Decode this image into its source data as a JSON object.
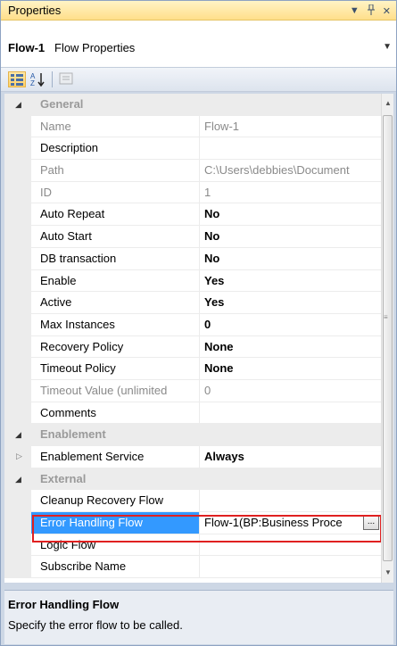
{
  "window": {
    "title": "Properties",
    "menu_icon": "▼",
    "pin_icon": "ꟸ",
    "close_icon": "✕"
  },
  "selector": {
    "name": "Flow-1",
    "type": "Flow Properties"
  },
  "toolbar": {
    "categorized_icon": "categorized-icon",
    "alphabetical_icon": "alphabetical-icon",
    "property_pages_icon": "property-pages-icon"
  },
  "grid": {
    "rows": [
      {
        "kind": "category",
        "label": "General",
        "expanded": true
      },
      {
        "kind": "prop",
        "name": "Name",
        "value": "Flow-1",
        "readonly": true
      },
      {
        "kind": "prop",
        "name": "Description",
        "value": ""
      },
      {
        "kind": "prop",
        "name": "Path",
        "value": "C:\\Users\\debbies\\Document",
        "readonly": true
      },
      {
        "kind": "prop",
        "name": "ID",
        "value": "1",
        "readonly": true
      },
      {
        "kind": "prop",
        "name": "Auto Repeat",
        "value": "No",
        "bold": true
      },
      {
        "kind": "prop",
        "name": "Auto Start",
        "value": "No",
        "bold": true
      },
      {
        "kind": "prop",
        "name": "DB transaction",
        "value": "No",
        "bold": true
      },
      {
        "kind": "prop",
        "name": "Enable",
        "value": "Yes",
        "bold": true
      },
      {
        "kind": "prop",
        "name": "Active",
        "value": "Yes",
        "bold": true
      },
      {
        "kind": "prop",
        "name": "Max Instances",
        "value": "0",
        "bold": true
      },
      {
        "kind": "prop",
        "name": "Recovery Policy",
        "value": "None",
        "bold": true
      },
      {
        "kind": "prop",
        "name": "Timeout Policy",
        "value": "None",
        "bold": true
      },
      {
        "kind": "prop",
        "name": "Timeout Value (unlimited",
        "value": "0",
        "readonly": true
      },
      {
        "kind": "prop",
        "name": "Comments",
        "value": ""
      },
      {
        "kind": "category",
        "label": "Enablement",
        "expanded": true
      },
      {
        "kind": "prop",
        "name": "Enablement Service",
        "value": "Always",
        "bold": true,
        "expander": true
      },
      {
        "kind": "category",
        "label": "External",
        "expanded": true
      },
      {
        "kind": "prop",
        "name": "Cleanup Recovery Flow",
        "value": ""
      },
      {
        "kind": "prop",
        "name": "Error Handling Flow",
        "value": "Flow-1(BP:Business Proce",
        "selected": true
      },
      {
        "kind": "prop",
        "name": "Logic Flow",
        "value": ""
      },
      {
        "kind": "prop",
        "name": "Subscribe Name",
        "value": ""
      }
    ],
    "ellipsis_label": "..."
  },
  "description": {
    "title": "Error Handling Flow",
    "text": "Specify the error flow to be called."
  }
}
